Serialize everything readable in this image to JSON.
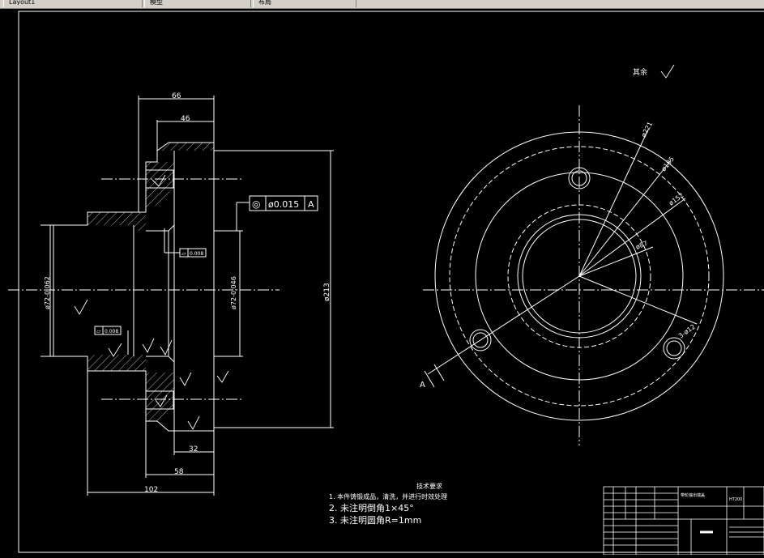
{
  "tabs": [
    {
      "label": "Layout1"
    },
    {
      "label": "模型"
    },
    {
      "label": "布局"
    }
  ],
  "drawing": {
    "dims": {
      "d66": "66",
      "d46": "46",
      "d32": "32",
      "d58": "58",
      "d102": "102",
      "dia213": "ø213",
      "dia72_left": "ø72-0.062",
      "dia72_right": "ø72-0.046",
      "dia221": "ø221",
      "dia185": "ø185",
      "dia152": "ø152",
      "dia87": "ø87",
      "holes": "3-ø12"
    },
    "tolerance": {
      "symbol": "◎",
      "value": "ø0.015",
      "datum": "A"
    },
    "flatness_1": "0.008",
    "flatness_2": "0.008",
    "roughness_note": "其余",
    "section_label": "A",
    "tech": {
      "title": "技术要求",
      "line1": "1. 本件铸锻成品，清洗，并进行时效处理",
      "line2": "2. 未注明倒角1×45°",
      "line3": "3. 未注明圆角R=1mm"
    },
    "title_block": {
      "part_name": "带轮输出端盖",
      "material": "HT200"
    }
  },
  "colors": {
    "background": "#000000",
    "lines": "#ffffff",
    "ui_gray": "#d4d0c8"
  }
}
